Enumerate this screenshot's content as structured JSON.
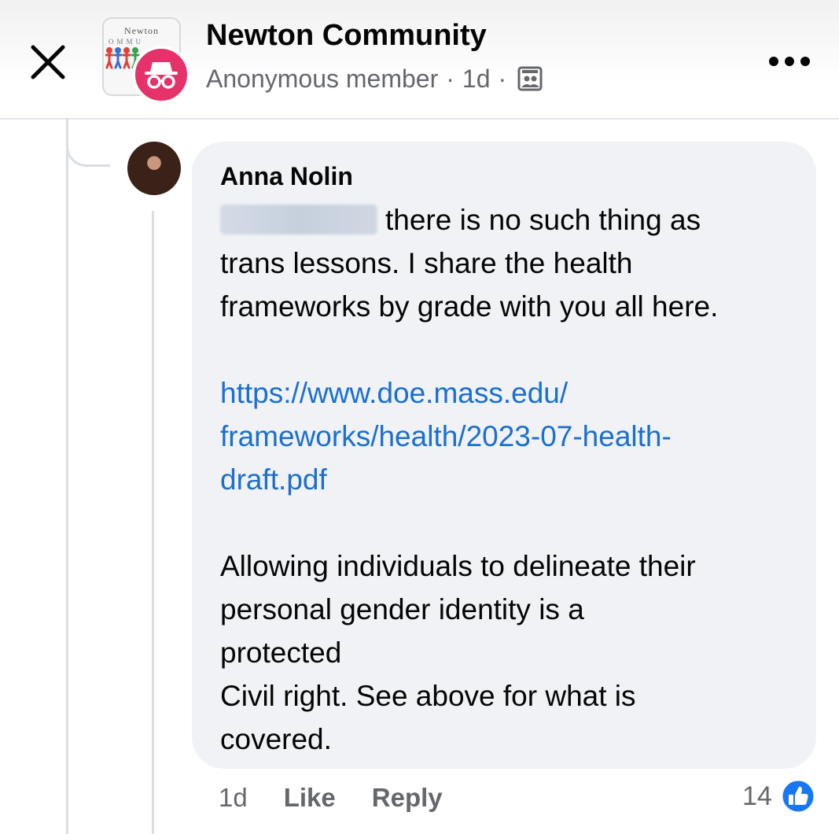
{
  "header": {
    "group_name": "Newton Community",
    "author_label": "Anonymous member",
    "separator": "·",
    "time": "1d",
    "logo_text": "Newton",
    "logo_sub": "OMMU",
    "icons": {
      "close": "close-icon",
      "more": "more-options-icon",
      "audience": "group-audience-icon",
      "anonymous": "incognito-icon"
    }
  },
  "comment": {
    "author": "Anna Nolin",
    "mention_blurred": true,
    "text_lines_1": [
      "there is no such thing as",
      "trans lessons. I share the health",
      "frameworks by grade with you all here."
    ],
    "link_lines": [
      "https://www.doe.mass.edu/",
      "frameworks/health/2023-07-health-",
      "draft.pdf"
    ],
    "text_lines_2": [
      "Allowing individuals to delineate their",
      "personal gender identity is a",
      "protected",
      "Civil right. See above for what is",
      "covered."
    ],
    "time": "1d",
    "like_label": "Like",
    "reply_label": "Reply",
    "reaction_count": "14",
    "reaction_icon": "like-reaction-icon"
  },
  "colors": {
    "bubble": "#f0f2f5",
    "link": "#1a6fd0",
    "secondary_text": "#65676b",
    "anon_badge": "#e5326b",
    "like_blue": "#1877f2"
  }
}
